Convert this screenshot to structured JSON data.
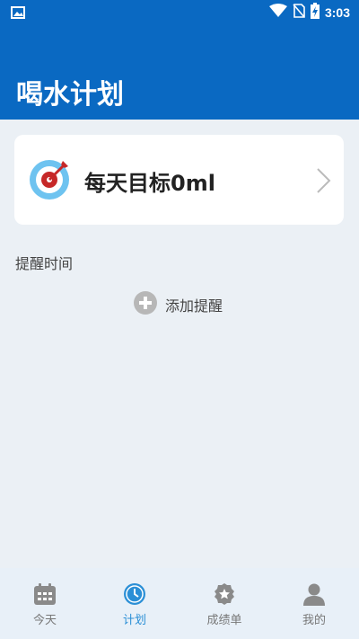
{
  "status_bar": {
    "time": "3:03",
    "icons": [
      "image-icon",
      "wifi-icon",
      "no-sim-icon",
      "battery-charging-icon"
    ]
  },
  "app_bar": {
    "title": "喝水计划"
  },
  "goal_card": {
    "icon": "target-icon",
    "text": "每天目标0ml"
  },
  "reminders": {
    "section_label": "提醒时间",
    "add_label": "添加提醒",
    "add_icon": "plus-circle-icon"
  },
  "bottom_nav": {
    "items": [
      {
        "label": "今天",
        "icon": "calendar-icon",
        "active": false
      },
      {
        "label": "计划",
        "icon": "clock-icon",
        "active": true
      },
      {
        "label": "成绩单",
        "icon": "badge-star-icon",
        "active": false
      },
      {
        "label": "我的",
        "icon": "person-icon",
        "active": false
      }
    ]
  },
  "colors": {
    "primary": "#0a69c2",
    "accent": "#2b8fd6",
    "background": "#ebf0f5",
    "target_red": "#c62828",
    "target_blue": "#6ec3f0"
  }
}
